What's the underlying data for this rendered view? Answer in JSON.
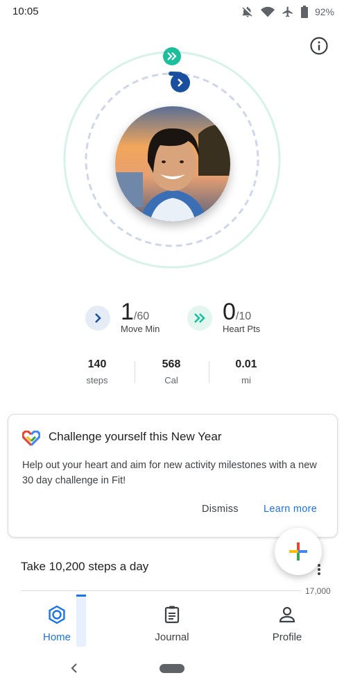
{
  "status": {
    "time": "10:05",
    "battery": "92%",
    "icons": [
      "notifications-off-icon",
      "wifi-icon",
      "airplane-icon",
      "battery-icon"
    ]
  },
  "colors": {
    "heart_pts": "#1bbf9b",
    "move_min": "#1a4fa0",
    "accent_blue": "#1a73e8",
    "ring_outer": "#d6f2ea",
    "ring_inner": "#cfd6ea"
  },
  "goals": {
    "move_min": {
      "value": "1",
      "goal": "/60",
      "label": "Move Min"
    },
    "heart_pts": {
      "value": "0",
      "goal": "/10",
      "label": "Heart Pts"
    }
  },
  "stats": [
    {
      "value": "140",
      "unit": "steps"
    },
    {
      "value": "568",
      "unit": "Cal"
    },
    {
      "value": "0.01",
      "unit": "mi"
    }
  ],
  "card": {
    "title": "Challenge yourself this New Year",
    "body": "Help out your heart and aim for new activity milestones with a new 30 day challenge in Fit!",
    "dismiss": "Dismiss",
    "learn_more": "Learn more"
  },
  "steps_section": {
    "title": "Take 10,200 steps a day",
    "axis_label": "17,000"
  },
  "nav": {
    "home": "Home",
    "journal": "Journal",
    "profile": "Profile"
  }
}
